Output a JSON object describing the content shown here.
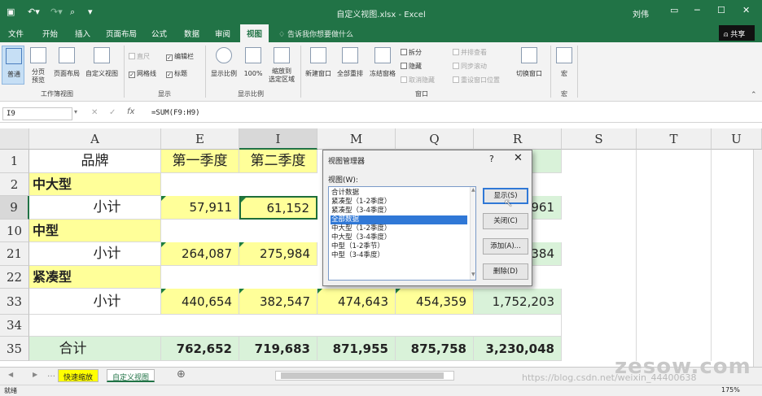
{
  "window": {
    "title": "自定义视图.xlsx  -  Excel",
    "user": "刘伟"
  },
  "tabs": [
    "文件",
    "开始",
    "插入",
    "页面布局",
    "公式",
    "数据",
    "审阅",
    "视图"
  ],
  "tell_me": "告诉我你想要做什么",
  "share": "共享",
  "ribbon": {
    "workbook_views": {
      "label": "工作簿视图",
      "normal": "普通",
      "page_break": "分页\n预览",
      "page_layout": "页面布局",
      "custom": "自定义视图"
    },
    "show": {
      "label": "显示",
      "ruler": "直尺",
      "formula_bar": "编辑栏",
      "gridlines": "网格线",
      "headings": "标题"
    },
    "zoom": {
      "label": "显示比例",
      "zoom": "显示比例",
      "hundred": "100%",
      "to_selection": "缩放到\n选定区域"
    },
    "window": {
      "label": "窗口",
      "new_window": "新建窗口",
      "arrange_all": "全部重排",
      "freeze": "冻结窗格",
      "split": "拆分",
      "hide": "隐藏",
      "unhide": "取消隐藏",
      "side_by_side": "并排查看",
      "sync_scroll": "同步滚动",
      "reset_pos": "重设窗口位置",
      "switch": "切换窗口"
    },
    "macros": {
      "label": "宏",
      "macro": "宏"
    }
  },
  "formula_bar": {
    "name_box": "I9",
    "formula": "=SUM(F9:H9)"
  },
  "columns": [
    "A",
    "E",
    "I",
    "M",
    "Q",
    "R",
    "S",
    "T",
    "U"
  ],
  "rows": [
    "1",
    "2",
    "9",
    "10",
    "21",
    "22",
    "33",
    "34",
    "35"
  ],
  "cells": {
    "r1": [
      "品牌",
      "第一季度",
      "第二季度"
    ],
    "r2": "中大型",
    "r9": [
      "小计",
      "57,911",
      "61,152",
      "961"
    ],
    "r10": "中型",
    "r21": [
      "小计",
      "264,087",
      "275,984",
      "384"
    ],
    "r22": "紧凑型",
    "r33": [
      "小计",
      "440,654",
      "382,547",
      "474,643",
      "454,359",
      "1,752,203"
    ],
    "r35": [
      "合计",
      "762,652",
      "719,683",
      "871,955",
      "875,758",
      "3,230,048"
    ]
  },
  "dialog": {
    "title": "视图管理器",
    "help": "?",
    "close": "✕",
    "list_label": "视图(W):",
    "views": [
      "合计数据",
      "紧凑型（1-2季度）",
      "紧凑型（3-4季度）",
      "全部数据",
      "中大型（1-2季度）",
      "中大型（3-4季度）",
      "中型（1-2季节）",
      "中型（3-4季度）"
    ],
    "selected_index": 3,
    "buttons": {
      "show": "显示(S)",
      "close": "关闭(C)",
      "add": "添加(A)...",
      "delete": "删除(D)"
    }
  },
  "sheets": [
    "快速缩放",
    "自定义视图"
  ],
  "status": {
    "ready": "就绪",
    "zoom": "175%"
  },
  "watermark": "https://blog.csdn.net/weixin_44400638",
  "watermark2": "zesow.com",
  "colors": {
    "excel_green": "#217346",
    "header_yellow": "#ffff99",
    "total_green": "#d9f2d9",
    "selection": "#3078d6"
  }
}
